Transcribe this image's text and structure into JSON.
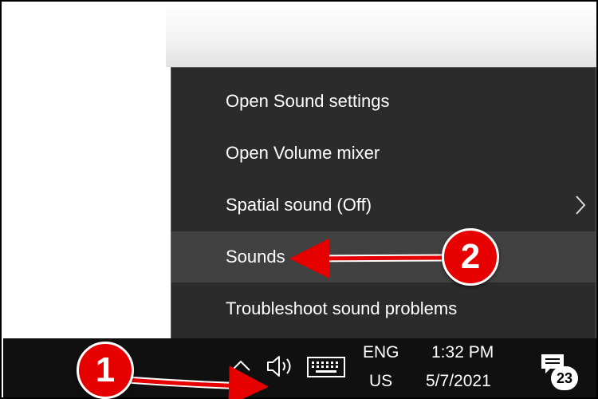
{
  "menu": {
    "items": [
      {
        "label": "Open Sound settings"
      },
      {
        "label": "Open Volume mixer"
      },
      {
        "label": "Spatial sound (Off)",
        "has_submenu": true
      },
      {
        "label": "Sounds",
        "highlighted": true
      },
      {
        "label": "Troubleshoot sound problems"
      }
    ]
  },
  "taskbar": {
    "language_line1": "ENG",
    "language_line2": "US",
    "time": "1:32 PM",
    "date": "5/7/2021",
    "notification_count": "23",
    "icons": [
      "chevron-up-icon",
      "speaker-icon",
      "keyboard-icon",
      "action-center-icon"
    ]
  },
  "annotations": {
    "callout_1": "1",
    "callout_2": "2",
    "color": "#e60000"
  },
  "colors": {
    "menu_background": "#2b2b2b",
    "menu_highlight": "#414141",
    "taskbar_background": "#101010"
  }
}
